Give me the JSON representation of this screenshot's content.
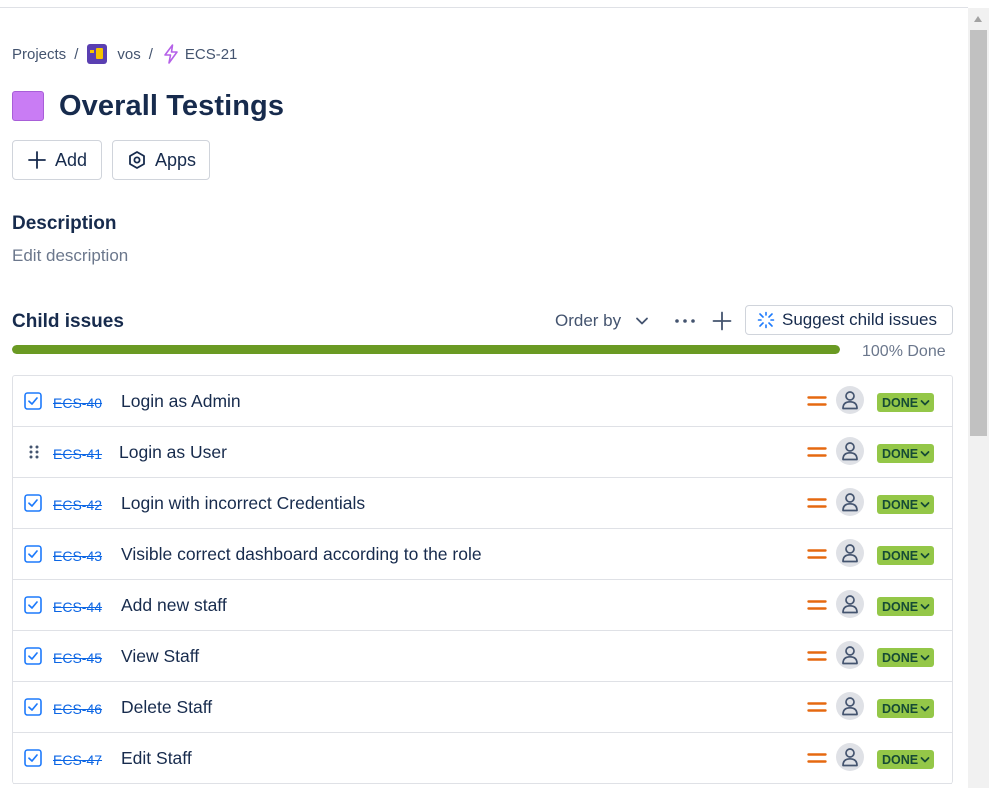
{
  "breadcrumb": {
    "projects": "Projects",
    "project_name": "vos",
    "parent_key": "ECS-21",
    "separator": "/"
  },
  "issue": {
    "title": "Overall Testings",
    "epic_color": "#c97cf4"
  },
  "actions": {
    "add_label": "Add",
    "apps_label": "Apps"
  },
  "description": {
    "heading": "Description",
    "placeholder": "Edit description"
  },
  "child_issues": {
    "heading": "Child issues",
    "order_by_label": "Order by",
    "suggest_label": "Suggest child issues",
    "progress_percent": 100,
    "progress_label": "100% Done",
    "progress_color": "#6a9a23",
    "items": [
      {
        "type_icon": "checkbox-icon",
        "key": "ECS-40",
        "summary": "Login as Admin",
        "priority": "medium",
        "status": "DONE"
      },
      {
        "type_icon": "drag-handle-icon",
        "key": "ECS-41",
        "summary": "Login as User",
        "priority": "medium",
        "status": "DONE"
      },
      {
        "type_icon": "checkbox-icon",
        "key": "ECS-42",
        "summary": "Login with incorrect Credentials",
        "priority": "medium",
        "status": "DONE"
      },
      {
        "type_icon": "checkbox-icon",
        "key": "ECS-43",
        "summary": "Visible correct dashboard according to the role",
        "priority": "medium",
        "status": "DONE"
      },
      {
        "type_icon": "checkbox-icon",
        "key": "ECS-44",
        "summary": "Add new staff",
        "priority": "medium",
        "status": "DONE"
      },
      {
        "type_icon": "checkbox-icon",
        "key": "ECS-45",
        "summary": "View Staff",
        "priority": "medium",
        "status": "DONE"
      },
      {
        "type_icon": "checkbox-icon",
        "key": "ECS-46",
        "summary": "Delete Staff",
        "priority": "medium",
        "status": "DONE"
      },
      {
        "type_icon": "checkbox-icon",
        "key": "ECS-47",
        "summary": "Edit Staff",
        "priority": "medium",
        "status": "DONE"
      }
    ]
  },
  "colors": {
    "link": "#0c66e4",
    "status_done_bg": "#94c748",
    "priority_medium": "#e56910"
  }
}
